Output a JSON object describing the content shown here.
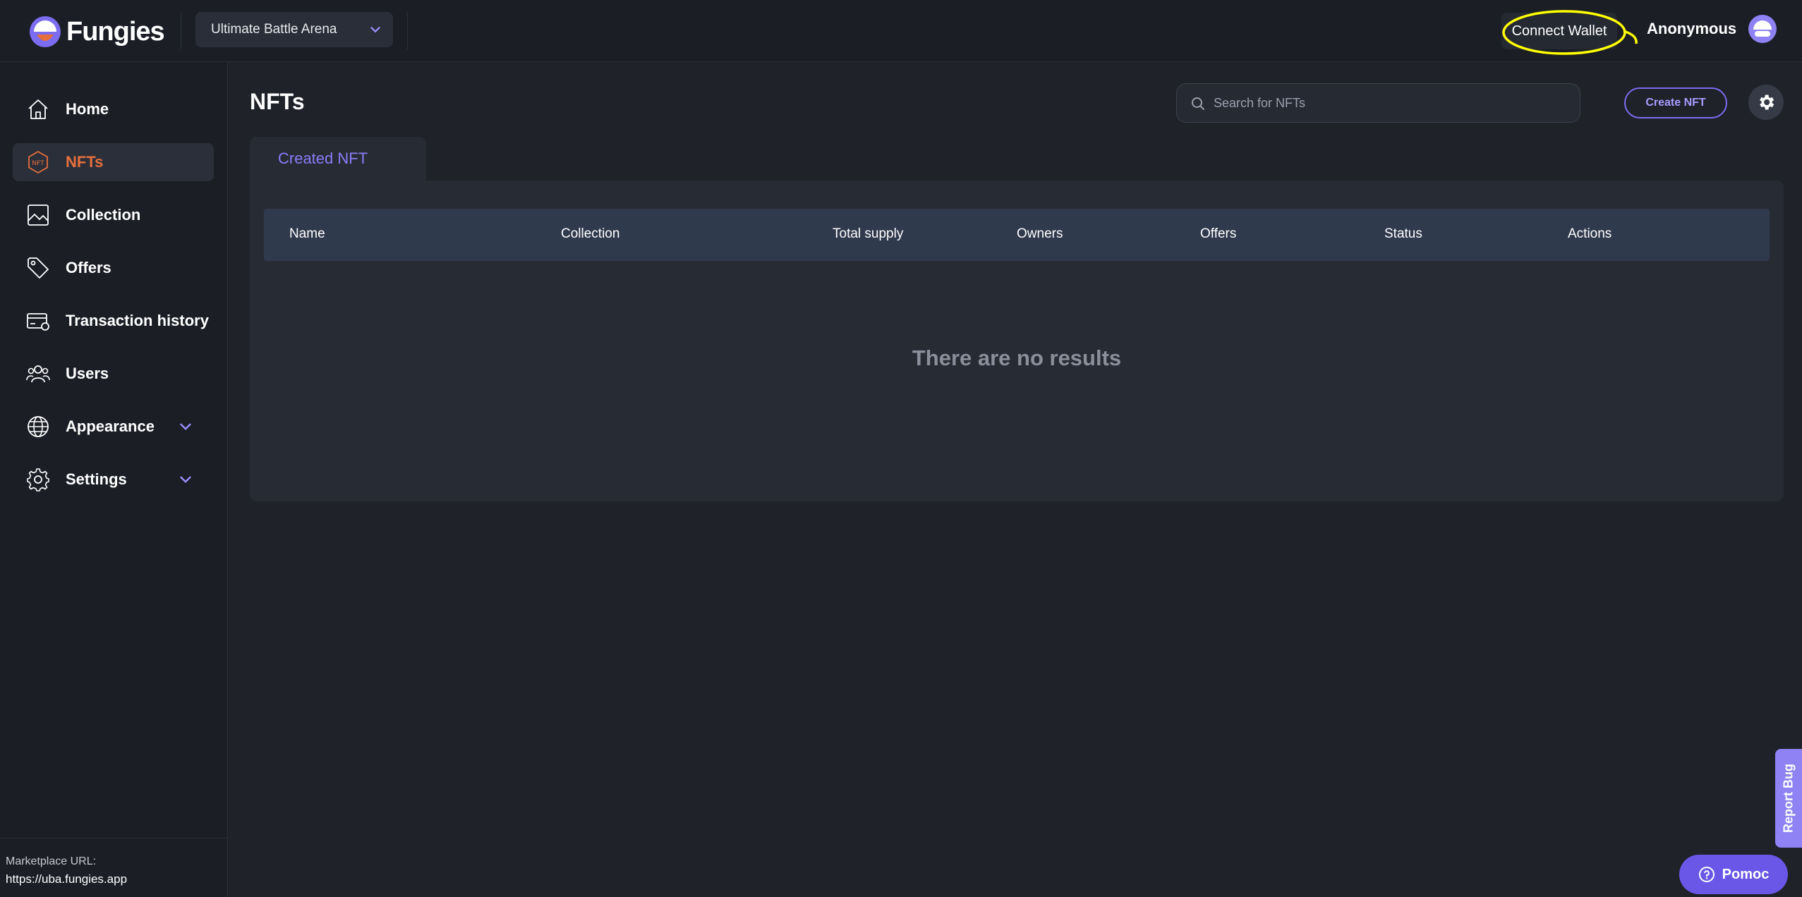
{
  "brand": {
    "name": "Fungies"
  },
  "header": {
    "project_selector": "Ultimate Battle Arena",
    "connect_wallet": "Connect Wallet",
    "user_name": "Anonymous"
  },
  "sidebar": {
    "items": [
      {
        "label": "Home",
        "icon": "home-icon"
      },
      {
        "label": "NFTs",
        "icon": "nft-icon",
        "active": true
      },
      {
        "label": "Collection",
        "icon": "image-icon"
      },
      {
        "label": "Offers",
        "icon": "tag-icon"
      },
      {
        "label": "Transaction history",
        "icon": "card-icon"
      },
      {
        "label": "Users",
        "icon": "users-icon"
      },
      {
        "label": "Appearance",
        "icon": "globe-icon",
        "expandable": true
      },
      {
        "label": "Settings",
        "icon": "gear-icon",
        "expandable": true
      }
    ],
    "footer": {
      "label": "Marketplace URL:",
      "url": "https://uba.fungies.app"
    }
  },
  "main": {
    "title": "NFTs",
    "search": {
      "placeholder": "Search for NFTs",
      "value": ""
    },
    "create_button": "Create NFT",
    "tabs": [
      {
        "label": "Created NFT",
        "active": true
      }
    ],
    "table": {
      "columns": [
        "Name",
        "Collection",
        "Total supply",
        "Owners",
        "Offers",
        "Status",
        "Actions"
      ],
      "rows": [],
      "empty_message": "There are no results"
    }
  },
  "widgets": {
    "report_bug": "Report Bug",
    "help": "Pomoc"
  },
  "colors": {
    "background": "#1f2229",
    "sidebar": "#1b1e25",
    "accent": "#7c6cf2",
    "active_nav": "#e76f3c",
    "highlight": "#ffff00"
  }
}
